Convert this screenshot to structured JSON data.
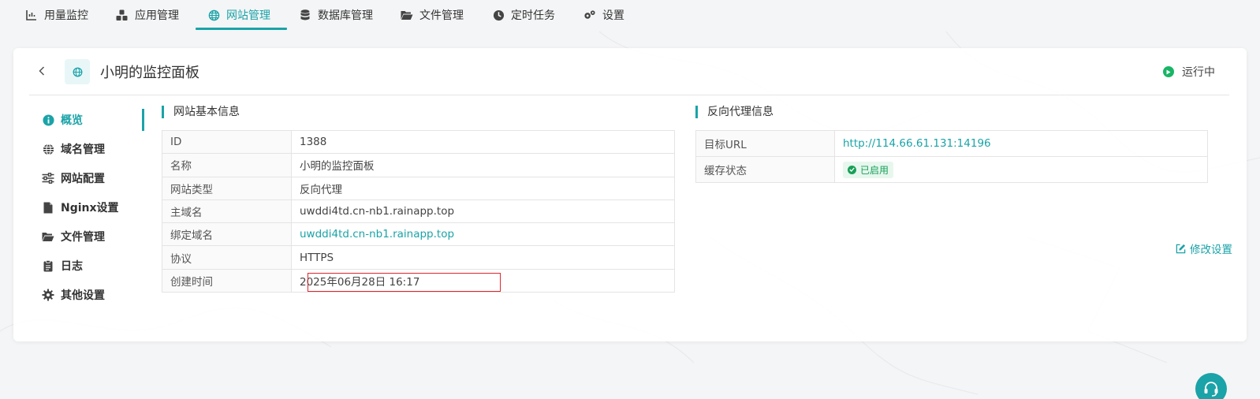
{
  "colors": {
    "accent": "#1aa3a8",
    "running": "#18b566",
    "enabled": "#18a058",
    "highlight": "#e0262f"
  },
  "topnav": {
    "tabs": [
      {
        "label": "用量监控",
        "icon": "bar-chart-icon"
      },
      {
        "label": "应用管理",
        "icon": "cubes-icon"
      },
      {
        "label": "网站管理",
        "icon": "globe-icon",
        "active": true
      },
      {
        "label": "数据库管理",
        "icon": "database-icon"
      },
      {
        "label": "文件管理",
        "icon": "folder-open-icon"
      },
      {
        "label": "定时任务",
        "icon": "clock-icon"
      },
      {
        "label": "设置",
        "icon": "gears-icon"
      }
    ]
  },
  "header": {
    "title": "小明的监控面板",
    "status": "运行中"
  },
  "sidemenu": {
    "items": [
      {
        "label": "概览",
        "icon": "info-circle-icon",
        "active": true
      },
      {
        "label": "域名管理",
        "icon": "globe-icon"
      },
      {
        "label": "网站配置",
        "icon": "sliders-icon"
      },
      {
        "label": "Nginx设置",
        "icon": "file-icon"
      },
      {
        "label": "文件管理",
        "icon": "folder-open-icon"
      },
      {
        "label": "日志",
        "icon": "clipboard-icon"
      },
      {
        "label": "其他设置",
        "icon": "gear-icon"
      }
    ]
  },
  "basic": {
    "title": "网站基本信息",
    "rows": [
      {
        "key": "ID",
        "value": "1388"
      },
      {
        "key": "名称",
        "value": "小明的监控面板"
      },
      {
        "key": "网站类型",
        "value": "反向代理"
      },
      {
        "key": "主域名",
        "value": "uwddi4td.cn-nb1.rainapp.top"
      },
      {
        "key": "绑定域名",
        "value": "uwddi4td.cn-nb1.rainapp.top"
      },
      {
        "key": "协议",
        "value": "HTTPS"
      },
      {
        "key": "创建时间",
        "value": "2025年06月28日 16:17"
      }
    ]
  },
  "proxy": {
    "title": "反向代理信息",
    "target_label": "目标URL",
    "target_url": "http://114.66.61.131:14196",
    "cache_label": "缓存状态",
    "cache_status": "已启用",
    "edit_label": "修改设置"
  }
}
